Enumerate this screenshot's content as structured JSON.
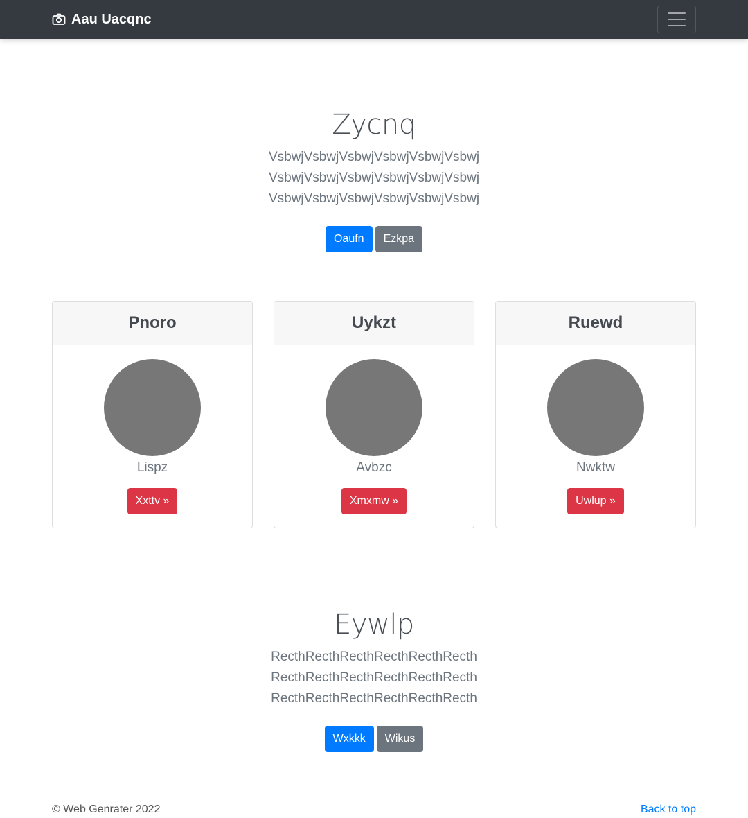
{
  "navbar": {
    "brand": "Aau Uacqnc",
    "brand_icon": "camera-icon",
    "toggler_icon": "hamburger-menu-icon",
    "background": "#343a40"
  },
  "hero1": {
    "title": "Zycnq",
    "lead": "VsbwjVsbwjVsbwjVsbwjVsbwjVsbwj VsbwjVsbwjVsbwjVsbwjVsbwjVsbwj VsbwjVsbwjVsbwjVsbwjVsbwjVsbwj",
    "primary_button": "Oaufn",
    "secondary_button": "Ezkpa"
  },
  "cards": [
    {
      "header": "Pnoro",
      "name": "Lispz",
      "button": "Xxttv »"
    },
    {
      "header": "Uykzt",
      "name": "Avbzc",
      "button": "Xmxmw »"
    },
    {
      "header": "Ruewd",
      "name": "Nwktw",
      "button": "Uwlup »"
    }
  ],
  "hero2": {
    "title": "Eywlp",
    "lead": "RecthRecthRecthRecthRecthRecth RecthRecthRecthRecthRecthRecth RecthRecthRecthRecthRecthRecth",
    "primary_button": "Wxkkk",
    "secondary_button": "Wikus"
  },
  "footer": {
    "copyright": "© Web Genrater 2022",
    "back_to_top": "Back to top"
  },
  "colors": {
    "primary": "#007bff",
    "secondary": "#6c757d",
    "danger": "#dc3545",
    "avatar": "#777777"
  }
}
